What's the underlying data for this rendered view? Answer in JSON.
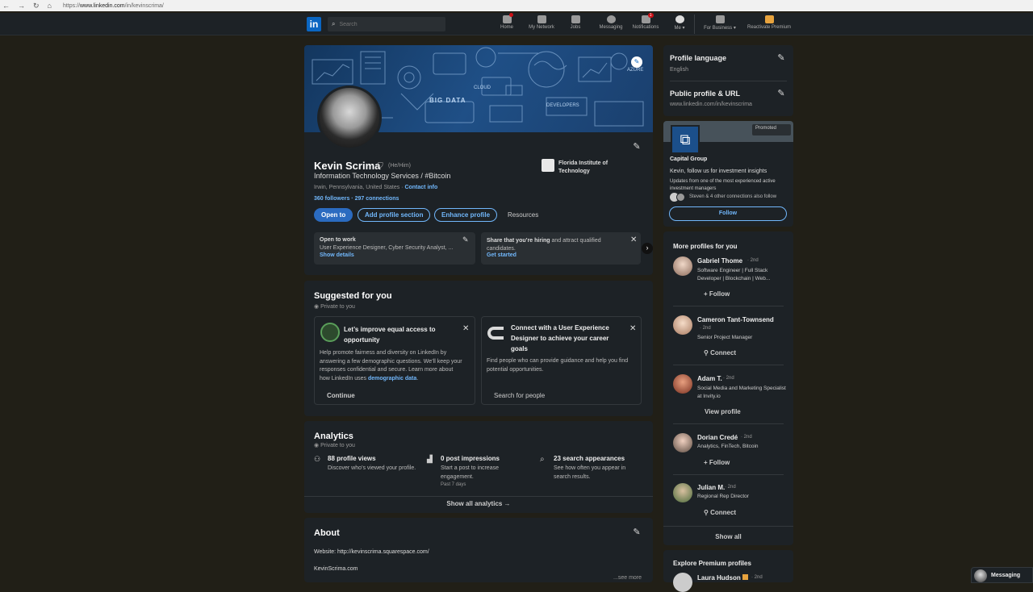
{
  "browser": {
    "url_prefix": "https://",
    "url_host": "www.linkedin.com",
    "url_path": "/in/kevinscrima/"
  },
  "nav": {
    "logo": "in",
    "search_placeholder": "Search",
    "items": [
      {
        "label": "Home"
      },
      {
        "label": "My Network"
      },
      {
        "label": "Jobs"
      },
      {
        "label": "Messaging"
      },
      {
        "label": "Notifications",
        "badge": "1"
      },
      {
        "label": "Me ▾"
      },
      {
        "label": "For Business ▾"
      },
      {
        "label": "Reactivate Premium"
      }
    ]
  },
  "profile": {
    "name": "Kevin Scrima",
    "pronouns": "(He/Him)",
    "headline": "Information Technology Services / #Bitcoin",
    "location": "Irwin, Pennsylvania, United States · ",
    "contact": "Contact info",
    "followers": "360 followers",
    "connections": " · 297 connections",
    "school": "Florida Institute of Technology",
    "buttons": {
      "open_to": "Open to",
      "add_section": "Add profile section",
      "enhance": "Enhance profile",
      "resources": "Resources"
    },
    "open_to_work": {
      "title": "Open to work",
      "detail": "User Experience Designer, Cyber Security Analyst, ...",
      "link": "Show details"
    },
    "hiring": {
      "bold": "Share that you’re hiring",
      "rest": " and attract qualified candidates.",
      "link": "Get started"
    }
  },
  "banner_words": {
    "w1": "BIG DATA",
    "w2": "CLOUD",
    "w3": "DEVELOPERS",
    "w4": "AZURE"
  },
  "suggested": {
    "title": "Suggested for you",
    "private": "Private to you",
    "card1": {
      "title": "Let’s improve equal access to opportunity",
      "body": "Help promote fairness and diversity on LinkedIn by answering a few demographic questions. We’ll keep your responses confidential and secure. Learn more about how LinkedIn uses ",
      "link": "demographic data",
      "end": ".",
      "button": "Continue"
    },
    "card2": {
      "title": "Connect with a User Experience Designer to achieve your career goals",
      "body": "Find people who can provide guidance and help you find potential opportunities.",
      "button": "Search for people"
    }
  },
  "analytics": {
    "title": "Analytics",
    "private": "Private to you",
    "items": [
      {
        "title": "88 profile views",
        "body": "Discover who’s viewed your profile."
      },
      {
        "title": "0 post impressions",
        "body": "Start a post to increase engagement.",
        "sub": "Past 7 days"
      },
      {
        "title": "23 search appearances",
        "body": "See how often you appear in search results."
      }
    ],
    "show_all": "Show all analytics →"
  },
  "about": {
    "title": "About",
    "website": "Website: http://kevinscrima.squarespace.com/",
    "name": "KevinScrima.com",
    "see_more": "...see more"
  },
  "sidebar": {
    "lang_title": "Profile language",
    "lang_value": "English",
    "url_title": "Public profile & URL",
    "url_value": "www.linkedin.com/in/kevinscrima"
  },
  "ad": {
    "promoted": "Promoted",
    "company": "Capital Group",
    "line1": "Kevin, follow us for investment insights",
    "line2": "Updates from one of the most experienced active investment managers",
    "social": "Steven & 4 other connections also follow",
    "follow": "Follow"
  },
  "more_profiles": {
    "title": "More profiles for you",
    "show_all": "Show all",
    "people": [
      {
        "name": "Gabriel Thome",
        "degree": " · 2nd",
        "headline": "Software Engineer | Full Stack Developer | Blockchain | Web...",
        "action": "+ Follow"
      },
      {
        "name": "Cameron Tant-Townsend",
        "degree": "· 2nd",
        "headline": "Senior Project Manager",
        "action": "Connect"
      },
      {
        "name": "Adam T.",
        "degree": " · 2nd",
        "headline": "Social Media and Marketing Specialist at Invity.io",
        "action": "View profile"
      },
      {
        "name": "Dorian Credé",
        "degree": " · 2nd",
        "headline": "Analytics, FinTech, Bitcoin",
        "action": "+ Follow"
      },
      {
        "name": "Julian M.",
        "degree": " · 2nd",
        "headline": "Regional Rep Director",
        "action": "Connect"
      }
    ]
  },
  "premium": {
    "title": "Explore Premium profiles",
    "person": "Laura Hudson",
    "degree": "· 2nd"
  },
  "messaging": {
    "label": "Messaging"
  },
  "colors": {
    "accent": "#71b7fb",
    "primary": "#0a66c2",
    "background": "#211f17",
    "card": "#1d2226"
  }
}
